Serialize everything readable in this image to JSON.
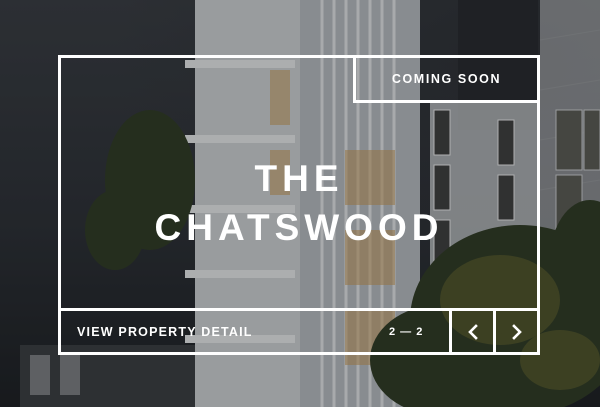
{
  "hero": {
    "badge": "COMING SOON",
    "title_line1": "THE",
    "title_line2": "CHATSWOOD",
    "detail_link": "VIEW PROPERTY DETAIL",
    "counter": "2 — 2"
  },
  "icons": {
    "prev": "chevron-left-icon",
    "next": "chevron-right-icon"
  },
  "colors": {
    "frame": "#ffffff",
    "background": "#2b2e33"
  }
}
